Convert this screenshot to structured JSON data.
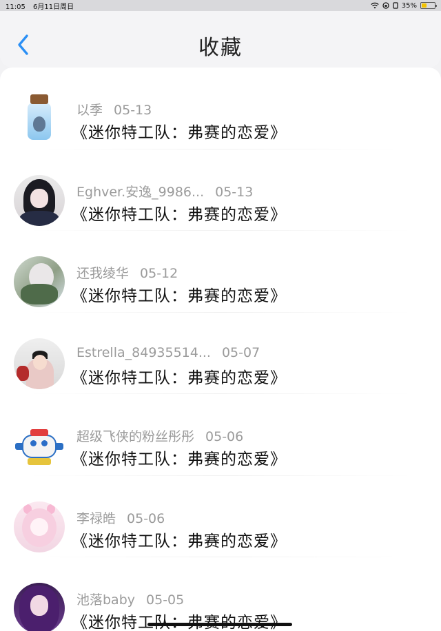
{
  "status_bar": {
    "time": "11:05",
    "date": "6月11日周日",
    "battery": "35%"
  },
  "header": {
    "title": "收藏",
    "back_icon": "chevron-left-icon"
  },
  "items": [
    {
      "user": "以季",
      "date": "05-13",
      "title": "《迷你特工队：弗赛的恋爱》",
      "avatar": "jar"
    },
    {
      "user": "Eghver.安逸_9986...",
      "date": "05-13",
      "title": "《迷你特工队：弗赛的恋爱》",
      "avatar": "girl"
    },
    {
      "user": "还我绫华",
      "date": "05-12",
      "title": "《迷你特工队：弗赛的恋爱》",
      "avatar": "anime"
    },
    {
      "user": "Estrella_84935514...",
      "date": "05-07",
      "title": "《迷你特工队：弗赛的恋爱》",
      "avatar": "baby"
    },
    {
      "user": "超级飞侠的粉丝彤彤",
      "date": "05-06",
      "title": "《迷你特工队：弗赛的恋爱》",
      "avatar": "plane"
    },
    {
      "user": "李禄皓",
      "date": "05-06",
      "title": "《迷你特工队：弗赛的恋爱》",
      "avatar": "pink"
    },
    {
      "user": "池落baby",
      "date": "05-05",
      "title": "《迷你特工队：弗赛的恋爱》",
      "avatar": "purple"
    }
  ],
  "colors": {
    "accent": "#2a8ff5",
    "username": "#9b9b9b",
    "title_text": "#111111"
  }
}
